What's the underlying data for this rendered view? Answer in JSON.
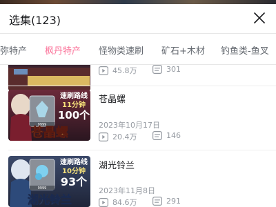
{
  "header": {
    "title": "选集(123)"
  },
  "tabs": [
    {
      "label": "弥特产",
      "active": false
    },
    {
      "label": "枫丹特产",
      "active": true
    },
    {
      "label": "怪物类速刷",
      "active": false
    },
    {
      "label": "矿石+木材",
      "active": false
    },
    {
      "label": "钓鱼类-鱼叉",
      "active": false
    }
  ],
  "colors": {
    "accent": "#fb7299",
    "text_secondary": "#9499a0"
  },
  "episodes": [
    {
      "title": "",
      "date": "",
      "views": "45.8万",
      "danmaku": "301",
      "thumb": {
        "overlay_lines": [],
        "item_count": ""
      }
    },
    {
      "title": "苍晶螺",
      "date": "2023年10月17日",
      "views": "20.4万",
      "danmaku": "146",
      "thumb": {
        "overlay_lines": [
          "速刷路线",
          "11分钟",
          "100个",
          "苍晶螺"
        ],
        "item_count": "9999"
      }
    },
    {
      "title": "湖光铃兰",
      "date": "2023年11月8日",
      "views": "84.6万",
      "danmaku": "291",
      "thumb": {
        "overlay_lines": [
          "速刷路线",
          "10分钟",
          "93个",
          "湖光铃兰"
        ],
        "item_count": "9999"
      }
    }
  ]
}
